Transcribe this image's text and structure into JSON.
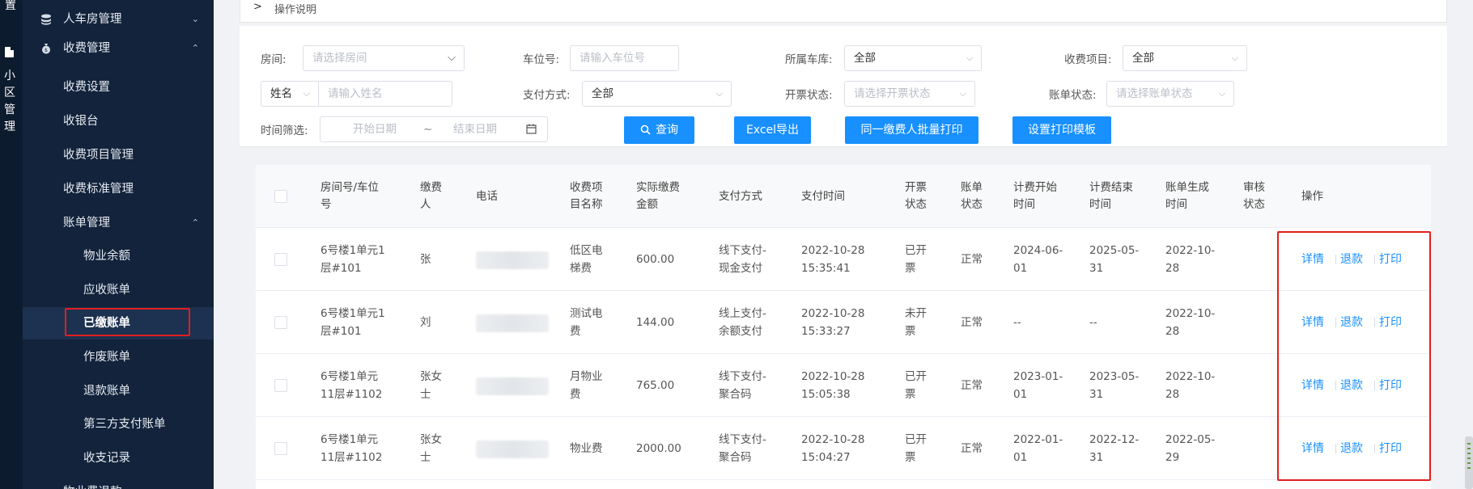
{
  "rail": {
    "top_text": "置",
    "vertical_label": "小区管理"
  },
  "sidebar": {
    "items": [
      {
        "label": "人车房管理",
        "chev": "⌄"
      },
      {
        "label": "收费管理",
        "chev": "⌃"
      },
      {
        "label": "收费设置"
      },
      {
        "label": "收银台"
      },
      {
        "label": "收费项目管理"
      },
      {
        "label": "收费标准管理"
      },
      {
        "label": "账单管理",
        "chev": "⌃"
      },
      {
        "label": "物业余额"
      },
      {
        "label": "应收账单"
      },
      {
        "label": "已缴账单"
      },
      {
        "label": "作废账单"
      },
      {
        "label": "退款账单"
      },
      {
        "label": "第三方支付账单"
      },
      {
        "label": "收支记录"
      },
      {
        "label": "物业费退款"
      }
    ]
  },
  "ops_bar": {
    "arrow": ">",
    "label": "操作说明"
  },
  "filters": {
    "room": {
      "label": "房间:",
      "placeholder": "请选择房间"
    },
    "space": {
      "label": "车位号:",
      "placeholder": "请输入车位号"
    },
    "garage": {
      "label": "所属车库:",
      "value": "全部"
    },
    "item": {
      "label": "收费项目:",
      "value": "全部"
    },
    "name": {
      "select": "姓名",
      "placeholder": "请输入姓名"
    },
    "pay_method": {
      "label": "支付方式:",
      "value": "全部"
    },
    "invoice": {
      "label": "开票状态:",
      "placeholder": "请选择开票状态"
    },
    "bill_status": {
      "label": "账单状态:",
      "placeholder": "请选择账单状态"
    },
    "time": {
      "label": "时间筛选:",
      "start": "开始日期",
      "tilde": "~",
      "end": "结束日期"
    },
    "buttons": {
      "query": "查询",
      "excel": "Excel导出",
      "batch_print": "同一缴费人批量打印",
      "template": "设置打印模板"
    }
  },
  "table": {
    "headers": {
      "room": [
        "房间号/车位",
        "号"
      ],
      "payer": [
        "缴费",
        "人"
      ],
      "phone": "电话",
      "item": [
        "收费项",
        "目名称"
      ],
      "amount": [
        "实际缴费",
        "金额"
      ],
      "method": "支付方式",
      "pay_time": "支付时间",
      "invoice": [
        "开票",
        "状态"
      ],
      "bill": [
        "账单",
        "状态"
      ],
      "start": [
        "计费开始",
        "时间"
      ],
      "end": [
        "计费结束",
        "时间"
      ],
      "gen": [
        "账单生成",
        "时间"
      ],
      "audit": [
        "审核",
        "状态"
      ],
      "ops": "操作"
    },
    "rows": [
      {
        "room": [
          "6号楼1单元1",
          "层#101"
        ],
        "payer": [
          "张"
        ],
        "item": [
          "低区电",
          "梯费"
        ],
        "amount": "600.00",
        "method": [
          "线下支付-",
          "现金支付"
        ],
        "pay_time": [
          "2022-10-28",
          "15:35:41"
        ],
        "invoice": [
          "已开",
          "票"
        ],
        "bill": "正常",
        "start": [
          "2024-06-",
          "01"
        ],
        "end": [
          "2025-05-",
          "31"
        ],
        "gen": [
          "2022-10-",
          "28"
        ]
      },
      {
        "room": [
          "6号楼1单元1",
          "层#101"
        ],
        "payer": [
          "刘"
        ],
        "item": [
          "测试电",
          "费"
        ],
        "amount": "144.00",
        "method": [
          "线上支付-",
          "余额支付"
        ],
        "pay_time": [
          "2022-10-28",
          "15:33:27"
        ],
        "invoice": [
          "未开",
          "票"
        ],
        "bill": "正常",
        "start": [
          "--"
        ],
        "end": [
          "--"
        ],
        "gen": [
          "2022-10-",
          "28"
        ]
      },
      {
        "room": [
          "6号楼1单元",
          "11层#1102"
        ],
        "payer": [
          "张女",
          "士"
        ],
        "item": [
          "月物业",
          "费"
        ],
        "amount": "765.00",
        "method": [
          "线下支付-",
          "聚合码"
        ],
        "pay_time": [
          "2022-10-28",
          "15:05:38"
        ],
        "invoice": [
          "已开",
          "票"
        ],
        "bill": "正常",
        "start": [
          "2023-01-",
          "01"
        ],
        "end": [
          "2023-05-",
          "31"
        ],
        "gen": [
          "2022-10-",
          "28"
        ]
      },
      {
        "room": [
          "6号楼1单元",
          "11层#1102"
        ],
        "payer": [
          "张女",
          "士"
        ],
        "item": [
          "物业费"
        ],
        "amount": "2000.00",
        "method": [
          "线下支付-",
          "聚合码"
        ],
        "pay_time": [
          "2022-10-28",
          "15:04:27"
        ],
        "invoice": [
          "已开",
          "票"
        ],
        "bill": "正常",
        "start": [
          "2022-01-",
          "01"
        ],
        "end": [
          "2022-12-",
          "31"
        ],
        "gen": [
          "2022-05-",
          "29"
        ]
      }
    ],
    "row_actions": {
      "detail": "详情",
      "refund": "退款",
      "print": "打印"
    }
  }
}
